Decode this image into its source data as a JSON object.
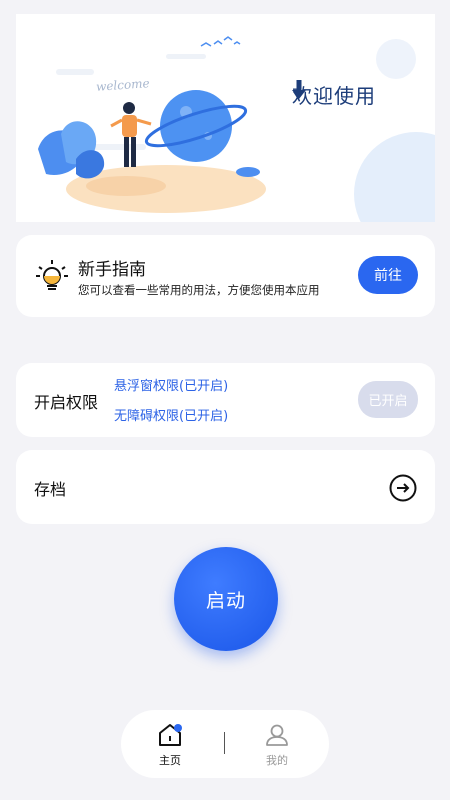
{
  "banner": {
    "title": "欢迎使用",
    "sign_text": "welcome"
  },
  "guide": {
    "title": "新手指南",
    "description": "您可以查看一些常用的用法，方便您使用本应用",
    "button": "前往"
  },
  "permissions": {
    "title": "开启权限",
    "items": [
      "悬浮窗权限(已开启)",
      "无障碍权限(已开启)"
    ],
    "button": "已开启"
  },
  "archive": {
    "title": "存档"
  },
  "start": {
    "label": "启动"
  },
  "bottom_nav": {
    "items": [
      {
        "label": "主页",
        "icon": "home-icon",
        "active": true
      },
      {
        "label": "我的",
        "icon": "profile-icon",
        "active": false
      }
    ]
  },
  "colors": {
    "accent": "#2a67f0",
    "background": "#f3f3f7",
    "link": "#2d63e6",
    "disabled": "#d8dcec"
  }
}
